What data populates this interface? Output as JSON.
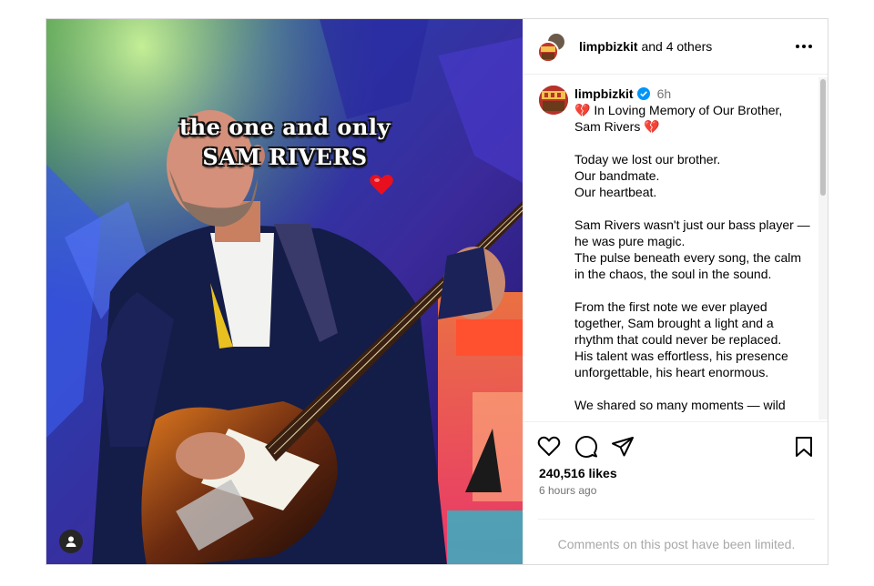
{
  "header": {
    "username": "limpbizkit",
    "collab_text": "and 4 others",
    "more_icon": "more-horizontal-icon"
  },
  "media": {
    "overlay_line1": "the one and only",
    "overlay_line2": "SAM RIVERS",
    "overlay_emoji": "heart-icon",
    "user_tag_icon": "user-tag-icon"
  },
  "caption": {
    "username": "limpbizkit",
    "time": "6h",
    "lines": [
      "💔 In Loving Memory of Our Brother, Sam Rivers 💔",
      "",
      "Today we lost our brother.",
      "Our bandmate.",
      "Our heartbeat.",
      "",
      "Sam Rivers wasn't just our bass player — he was pure magic.",
      "The pulse beneath every song, the calm in the chaos, the soul in the sound.",
      "",
      "From the first note we ever played together, Sam brought a light and a rhythm that could never be replaced.",
      "His talent was effortless, his presence unforgettable, his heart enormous.",
      "",
      "We shared so many moments — wild"
    ]
  },
  "actions": {
    "likes": "240,516 likes",
    "time_ago": "6 hours ago",
    "comments_limited": "Comments on this post have been limited."
  },
  "colors": {
    "verified": "#0095f6",
    "muted_text": "#737373",
    "limited_text": "#a8a8a8",
    "border": "#dbdbdb"
  }
}
